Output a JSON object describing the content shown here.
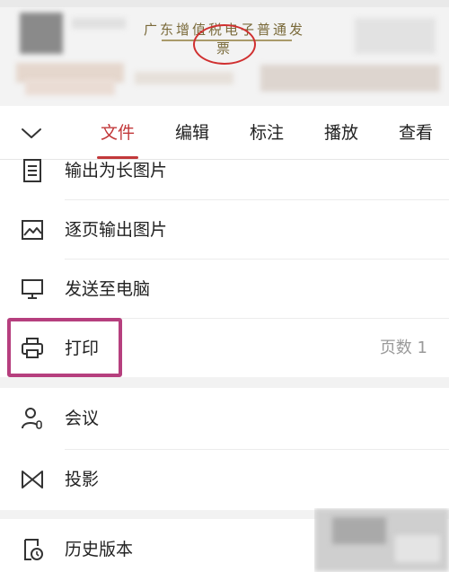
{
  "preview": {
    "invoice_title": "广东增值税电子普通发票"
  },
  "tabbar": {
    "tabs": [
      {
        "label": "文件",
        "active": true
      },
      {
        "label": "编辑",
        "active": false
      },
      {
        "label": "标注",
        "active": false
      },
      {
        "label": "播放",
        "active": false
      },
      {
        "label": "查看",
        "active": false
      }
    ]
  },
  "menu": {
    "items": [
      {
        "label": "输出为长图片",
        "icon": "long-image-icon"
      },
      {
        "label": "逐页输出图片",
        "icon": "image-icon"
      },
      {
        "label": "发送至电脑",
        "icon": "monitor-icon"
      },
      {
        "label": "打印",
        "icon": "printer-icon",
        "extra": "页数 1"
      },
      {
        "label": "会议",
        "icon": "meeting-user-icon"
      },
      {
        "label": "投影",
        "icon": "projection-icon"
      },
      {
        "label": "历史版本",
        "icon": "history-version-icon"
      }
    ]
  },
  "colors": {
    "accent": "#c2383a",
    "highlight": "#b63f7e",
    "muted_text": "#9a9a9a"
  }
}
